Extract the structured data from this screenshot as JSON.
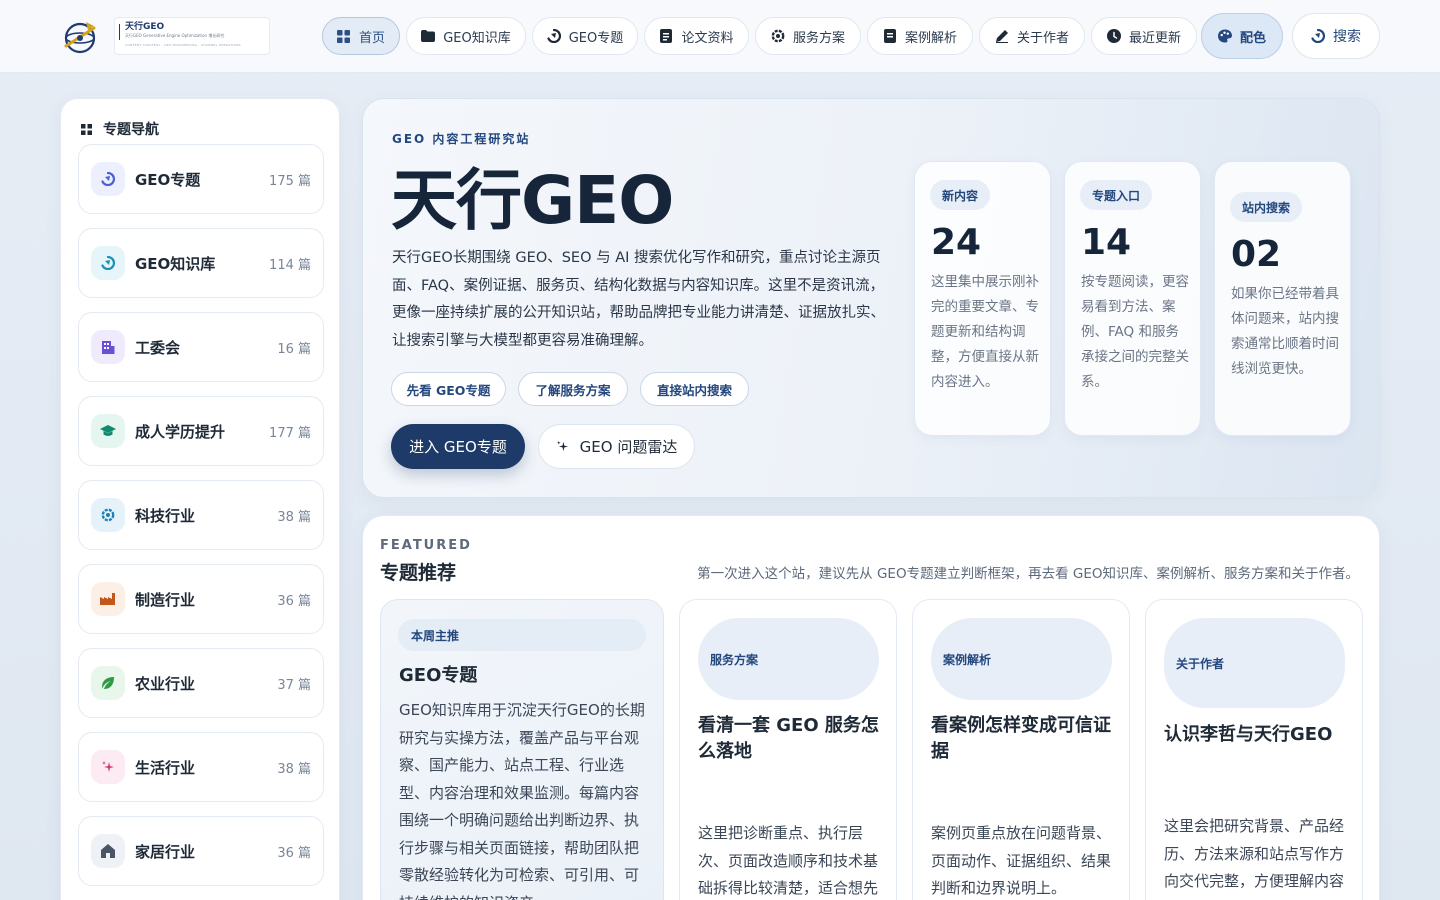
{
  "brand": {
    "name": "天行GEO",
    "tagline": "天行GEO Generative Engine Optimization 增长研究",
    "subtagline": "CONTENT STRATEGY · GEO ENGINEERING · CHANNEL OPERATIONS"
  },
  "nav": {
    "items": [
      {
        "label": "首页",
        "icon": "grid-icon",
        "active": true
      },
      {
        "label": "GEO知识库",
        "icon": "folder-icon"
      },
      {
        "label": "GEO专题",
        "icon": "compass-icon"
      },
      {
        "label": "论文资料",
        "icon": "document-icon"
      },
      {
        "label": "服务方案",
        "icon": "gear-icon"
      },
      {
        "label": "案例解析",
        "icon": "case-icon"
      },
      {
        "label": "关于作者",
        "icon": "pen-icon"
      },
      {
        "label": "最近更新",
        "icon": "clock-icon"
      }
    ],
    "color_label": "配色",
    "search_label": "搜索"
  },
  "sidebar": {
    "title": "专题导航",
    "unit": "篇",
    "items": [
      {
        "label": "GEO专题",
        "count": "175 篇",
        "icon": "compass-icon",
        "color": "#4a5fd1",
        "bg": "#eceffd"
      },
      {
        "label": "GEO知识库",
        "count": "114 篇",
        "icon": "compass-icon",
        "color": "#1c8fb3",
        "bg": "#e6f5f9"
      },
      {
        "label": "工委会",
        "count": "16 篇",
        "icon": "building-icon",
        "color": "#6a4fd6",
        "bg": "#efebfc"
      },
      {
        "label": "成人学历提升",
        "count": "177 篇",
        "icon": "graduation-cap-icon",
        "color": "#0f8a6e",
        "bg": "#e5f5f0"
      },
      {
        "label": "科技行业",
        "count": "38 篇",
        "icon": "chip-icon",
        "color": "#1b7fb8",
        "bg": "#e5f2fa"
      },
      {
        "label": "制造行业",
        "count": "36 篇",
        "icon": "factory-icon",
        "color": "#c2571a",
        "bg": "#fcefe5"
      },
      {
        "label": "农业行业",
        "count": "37 篇",
        "icon": "leaf-icon",
        "color": "#2f9a45",
        "bg": "#e8f6eb"
      },
      {
        "label": "生活行业",
        "count": "38 篇",
        "icon": "sparkle-icon",
        "color": "#d23a74",
        "bg": "#fcebf2"
      },
      {
        "label": "家居行业",
        "count": "36 篇",
        "icon": "home-icon",
        "color": "#4a5566",
        "bg": "#eef1f5"
      }
    ]
  },
  "hero": {
    "kicker": "GEO 内容工程研究站",
    "title": "天行GEO",
    "description": "天行GEO长期围绕 GEO、SEO 与 AI 搜索优化写作和研究，重点讨论主源页面、FAQ、案例证据、服务页、结构化数据与内容知识库。这里不是资讯流，更像一座持续扩展的公开知识站，帮助品牌把专业能力讲清楚、证据放扎实、让搜索引擎与大模型都更容易准确理解。",
    "pills": [
      "先看 GEO专题",
      "了解服务方案",
      "直接站内搜索"
    ],
    "primary_cta": "进入 GEO专题",
    "secondary_cta": "GEO 问题雷达",
    "stats": [
      {
        "tag": "新内容",
        "number": "24",
        "text": "这里集中展示刚补完的重要文章、专题更新和结构调整，方便直接从新内容进入。"
      },
      {
        "tag": "专题入口",
        "number": "14",
        "text": "按专题阅读，更容易看到方法、案例、FAQ 和服务承接之间的完整关系。"
      },
      {
        "tag": "站内搜索",
        "number": "02",
        "text": "如果你已经带着具体问题来，站内搜索通常比顺着时间线浏览更快。"
      }
    ]
  },
  "featured": {
    "kicker": "FEATURED",
    "title": "专题推荐",
    "note": "第一次进入这个站，建议先从 GEO专题建立判断框架，再去看 GEO知识库、案例解析、服务方案和关于作者。",
    "cards": [
      {
        "tag": "本周主推",
        "title": "GEO专题",
        "text": "GEO知识库用于沉淀天行GEO的长期研究与实操方法，覆盖产品与平台观察、国产能力、站点工程、行业选型、内容治理和效果监测。每篇内容围绕一个明确问题给出判断边界、执行步骤与相关页面链接，帮助团队把零散经验转化为可检索、可引用、可持续维护的知识资产。"
      },
      {
        "tag": "服务方案",
        "title": "看清一套 GEO 服务怎么落地",
        "text": "这里把诊断重点、执行层次、页面改造顺序和技术基础拆得比较清楚，适合想先了解合作方式的团队。"
      },
      {
        "tag": "案例解析",
        "title": "看案例怎样变成可信证据",
        "text": "案例页重点放在问题背景、页面动作、证据组织、结果判断和边界说明上。"
      },
      {
        "tag": "关于作者",
        "title": "认识李哲与天行GEO",
        "text": "这里会把研究背景、产品经历、方法来源和站点写作方向交代完整，方便理解内容出处。"
      }
    ]
  },
  "colors": {
    "navy": "#1e3a68",
    "accent": "#24487e",
    "page_bg": "#e3eaf3"
  }
}
